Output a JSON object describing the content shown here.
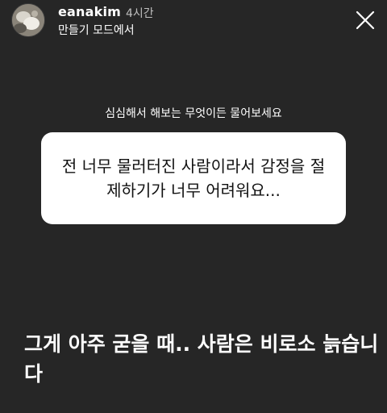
{
  "header": {
    "username": "eanakim",
    "time": "4시간",
    "subtitle": "만들기 모드에서",
    "avatar_icon": "profile-photo",
    "close_icon": "close-x-icon"
  },
  "story": {
    "prompt": "심심해서 해보는 무엇이든 물어보세요",
    "question": "전 너무 물러터진 사람이라서 감정을 절제하기가 너무 어려워요...",
    "answer": "그게 아주 굳을 때.. 사람은 비로소 늙습니다"
  },
  "colors": {
    "background": "#262626",
    "card": "#ffffff",
    "text_primary": "#ffffff",
    "text_muted": "#bfbfbf"
  }
}
